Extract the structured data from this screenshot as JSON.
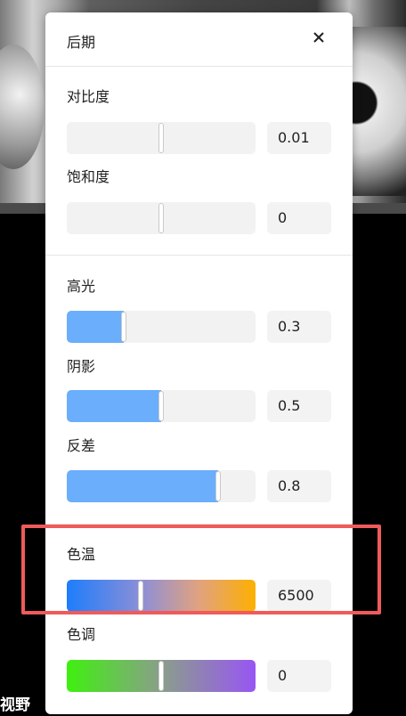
{
  "viewport": {
    "fov_label": "视野"
  },
  "panel": {
    "title": "后期",
    "close_icon": "close-icon",
    "sections": [
      {
        "items": [
          {
            "label": "对比度",
            "value": "0.01",
            "level": 0.5
          },
          {
            "label": "饱和度",
            "value": "0",
            "level": 0.5
          }
        ]
      },
      {
        "items": [
          {
            "label": "高光",
            "value": "0.3",
            "level": 0.3,
            "fill": true
          },
          {
            "label": "阴影",
            "value": "0.5",
            "level": 0.5,
            "fill": true
          },
          {
            "label": "反差",
            "value": "0.8",
            "level": 0.8,
            "fill": true
          }
        ]
      },
      {
        "items": [
          {
            "label": "色温",
            "value": "6500",
            "level": 0.39,
            "gradient": "temperature"
          },
          {
            "label": "色调",
            "value": "0",
            "level": 0.5,
            "gradient": "tint"
          }
        ]
      }
    ]
  },
  "colors": {
    "fill_blue": "#6aaefc",
    "highlight_red": "#f05a5a"
  }
}
